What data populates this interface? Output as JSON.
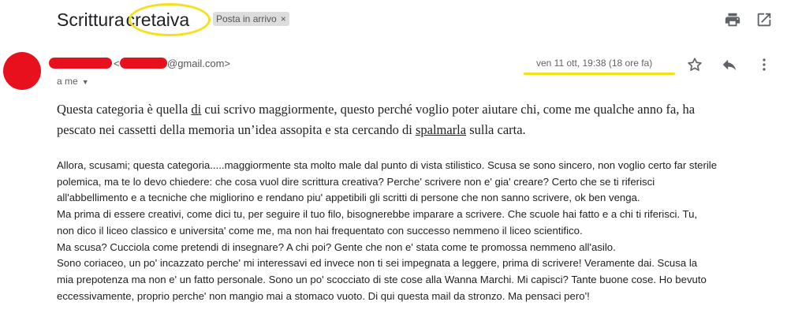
{
  "header": {
    "subject_word1": "Scrittura",
    "subject_word2": "cretaiva",
    "label": "Posta in arrivo",
    "label_close": "×",
    "print_icon": "printer-icon",
    "open_new_window_icon": "open-in-new-icon"
  },
  "message": {
    "sender_lt": "<",
    "sender_domain": "@gmail.com>",
    "to": "a me",
    "date": "ven 11 ott, 19:38 (18 ore fa)",
    "star_icon": "star-icon",
    "reply_icon": "reply-icon",
    "more_icon": "more-vertical-icon"
  },
  "body": {
    "p1_a": "Questa categoria è quella ",
    "p1_di": "di",
    "p1_b": " cui scrivo maggiormente, questo perché voglio poter aiutare chi, come me qualche anno fa, ha",
    "p1_c": "pescato nei cassetti della memoria un’idea assopita e sta cercando di ",
    "p1_spalmarla": "spalmarla",
    "p1_d": " sulla carta.",
    "reply_lines": [
      "Allora, scusami; questa categoria.....maggiormente sta molto male dal punto di vista stilistico. Scusa se sono sincero, non voglio certo far sterile",
      "polemica, ma te lo devo chiedere: che cosa vuol dire scrittura creativa? Perche' scrivere non e' gia' creare? Certo che se ti riferisci",
      "all'abbellimento e a tecniche che migliorino e rendano piu' appetibili gli scritti di persone che non sanno scrivere, ok ben venga.",
      "Ma prima di essere creativi, come dici tu, per seguire il tuo filo, bisognerebbe imparare a scrivere. Che scuole hai fatto e a chi ti riferisci. Tu,",
      "non dico il liceo classico e universita' come me, ma non hai frequentato con successo nemmeno il liceo scientifico.",
      "Ma scusa? Cucciola come pretendi di insegnare? A chi poi? Gente che non e' stata come te promossa nemmeno all'asilo.",
      "Sono coriaceo, un po' incazzato perche' mi interessavi ed invece non ti sei impegnata a leggere, prima di scrivere!  Veramente dai. Scusa la",
      "mia prepotenza ma non e' un fatto personale. Sono un po' scocciato di ste cose alla Wanna Marchi. Mi capisci?  Tante buone cose. Ho bevuto",
      "eccessivamente, proprio perche' non mangio mai a stomaco vuoto. Di qui questa mail da stronzo. Ma pensaci pero'!"
    ]
  },
  "colors": {
    "redaction": "#e8101c",
    "highlight_marker": "#f5e11a",
    "label_chip_bg": "#dddddd",
    "icon_gray": "#5f6368"
  }
}
